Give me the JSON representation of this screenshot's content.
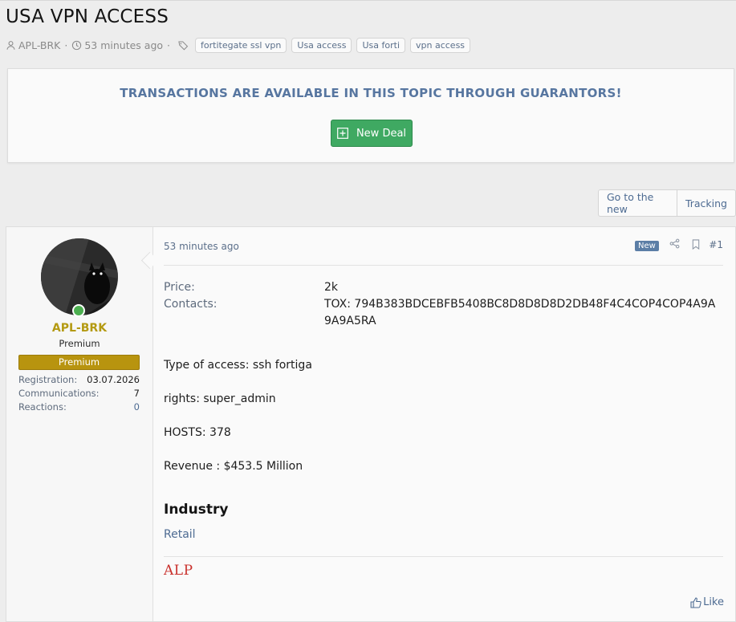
{
  "thread": {
    "title": "USA VPN ACCESS",
    "author": "APL-BRK",
    "time": "53 minutes ago",
    "tags": [
      "fortitegate ssl vpn",
      "Usa access",
      "Usa forti",
      "vpn access"
    ]
  },
  "notice": {
    "text": "TRANSACTIONS ARE AVAILABLE IN THIS TOPIC THROUGH GUARANTORS!",
    "button": "New Deal"
  },
  "nav": {
    "go_new": "Go to the new",
    "tracking": "Tracking"
  },
  "user": {
    "name": "APL-BRK",
    "title": "Premium",
    "banner": "Premium",
    "stats": [
      {
        "label": "Registration:",
        "value": "03.07.2026"
      },
      {
        "label": "Communications:",
        "value": "7"
      },
      {
        "label": "Reactions:",
        "value": "0"
      }
    ]
  },
  "post": {
    "time": "53 minutes ago",
    "badge": "New",
    "number": "#1",
    "fields": [
      {
        "label": "Price:",
        "value": "2k"
      },
      {
        "label": "Contacts:",
        "value": "TOX: 794B383BDCEBFB5408BC8D8D8D8D2DB48F4C4COP4COP4A9A9A9A5RA"
      }
    ],
    "body": [
      "Type of access: ssh fortiga",
      "rights: super_admin",
      "HOSTS: 378",
      "Revenue : $453.5 Million"
    ],
    "industry_heading": "Industry",
    "industry_value": "Retail",
    "signature": "ALP",
    "like": "Like"
  },
  "colors": {
    "accent": "#5776a0",
    "link": "#4d6b92",
    "deal_button": "#3fa962",
    "premium_gold": "#b8940f",
    "signature_red": "#c9302c",
    "online_green": "#4caf50"
  }
}
